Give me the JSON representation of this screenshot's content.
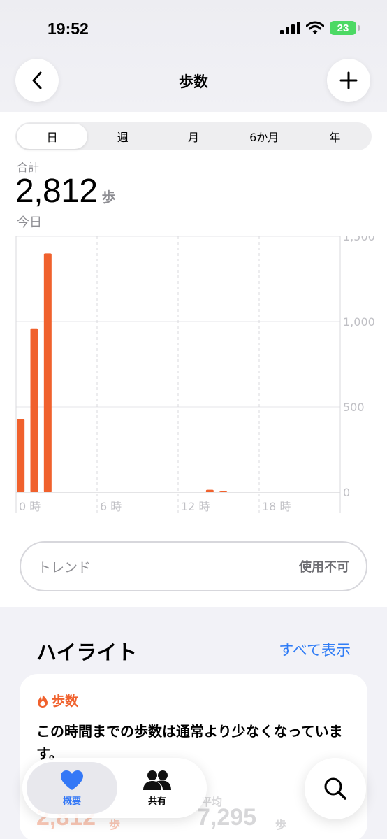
{
  "status_bar": {
    "time": "19:52",
    "battery": "23"
  },
  "nav": {
    "title": "歩数"
  },
  "periods": [
    "日",
    "週",
    "月",
    "6か月",
    "年"
  ],
  "summary": {
    "label": "合計",
    "value": "2,812",
    "unit": "歩",
    "date": "今日"
  },
  "chart_data": {
    "type": "bar",
    "x_tick_labels": [
      "0 時",
      "6 時",
      "12 時",
      "18 時"
    ],
    "y_tick_labels": [
      "1,500",
      "1,000",
      "500",
      "0"
    ],
    "ylim": [
      0,
      1500
    ],
    "xlim": [
      0,
      24
    ],
    "grid": true,
    "bar_color": "#f0612d",
    "hours": [
      0,
      1,
      2,
      14,
      15
    ],
    "values": [
      430,
      960,
      1400,
      14,
      7
    ]
  },
  "trend": {
    "label": "トレンド",
    "value": "使用不可"
  },
  "highlights": {
    "title": "ハイライト",
    "show_all": "すべて表示",
    "card": {
      "title": "歩数",
      "text": "この時間までの歩数は通常より少なくなっています。",
      "avg_label": "平均",
      "value_today": "2,812",
      "unit_today": "歩",
      "value_avg": "7,295",
      "unit_avg": "歩"
    }
  },
  "tab_bar": {
    "summary_label": "概要",
    "sharing_label": "共有"
  },
  "colors": {
    "accent": "#f0612d",
    "link": "#2f7cf6",
    "tab_active": "#3478f6"
  }
}
